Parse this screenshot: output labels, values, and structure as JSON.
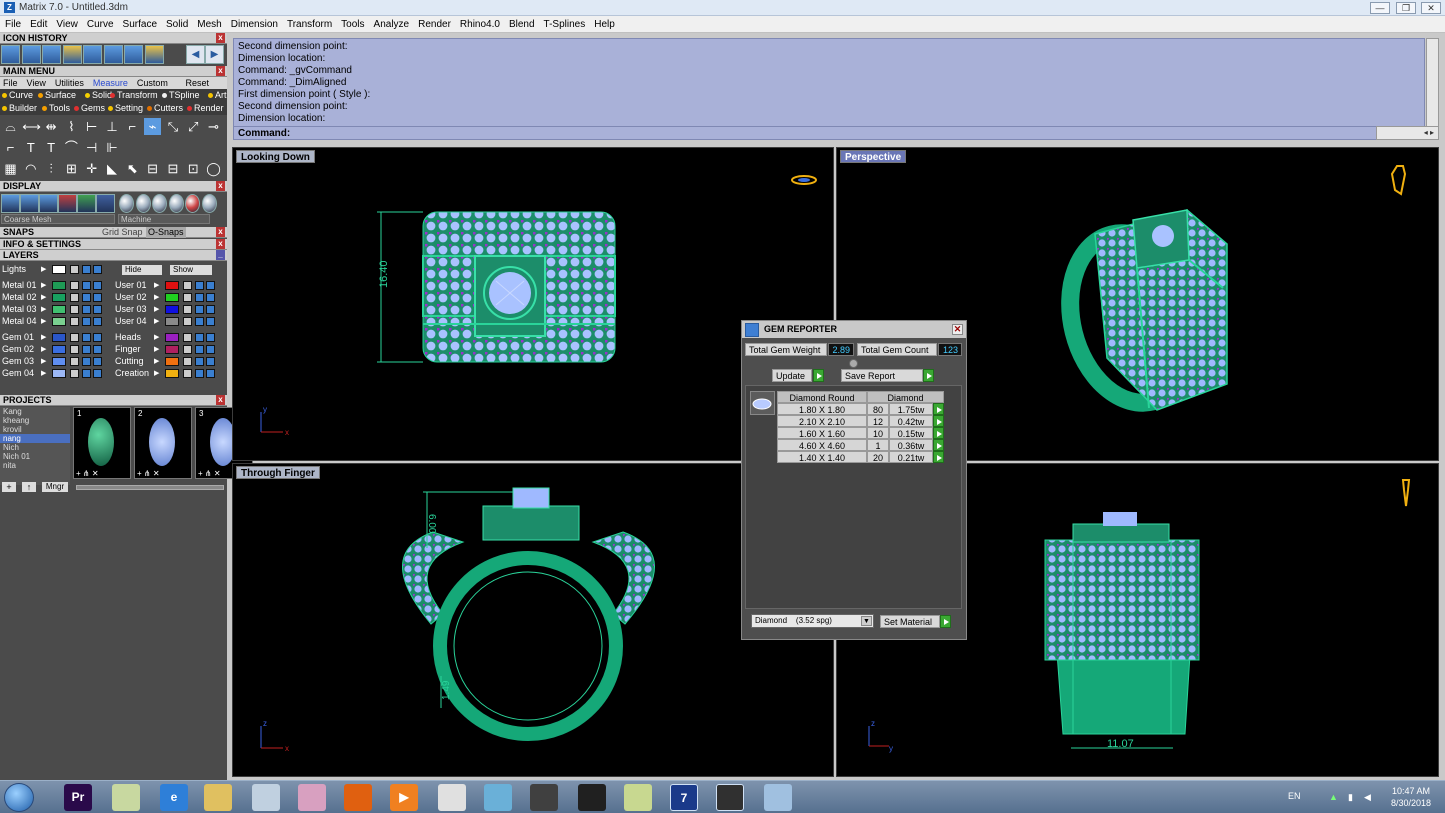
{
  "window": {
    "title": "Matrix 7.0 - Untitled.3dm",
    "min_btn": "—",
    "max_btn": "❐",
    "close_btn": "✕"
  },
  "menubar": [
    "File",
    "Edit",
    "View",
    "Curve",
    "Surface",
    "Solid",
    "Mesh",
    "Dimension",
    "Transform",
    "Tools",
    "Analyze",
    "Render",
    "Rhino4.0",
    "Blend",
    "T-Splines",
    "Help"
  ],
  "left": {
    "icon_history": "ICON HISTORY",
    "main_menu": "MAIN MENU",
    "tabs": [
      "File",
      "View",
      "Utilities",
      "Measure",
      "Custom"
    ],
    "tab_active": "Measure",
    "reset": "Reset",
    "categories_row1": [
      {
        "label": "Curve",
        "color": "#f5c400"
      },
      {
        "label": "Surface",
        "color": "#f5a000"
      },
      {
        "label": "Solid",
        "color": "#f5d000"
      },
      {
        "label": "Transform",
        "color": "#e03030"
      },
      {
        "label": "TSpline",
        "color": "#f0f0f0"
      },
      {
        "label": "Art",
        "color": "#f5c400"
      }
    ],
    "categories_row2": [
      {
        "label": "Builder",
        "color": "#f5c400"
      },
      {
        "label": "Tools",
        "color": "#f5a000"
      },
      {
        "label": "Gems",
        "color": "#e03030"
      },
      {
        "label": "Setting",
        "color": "#f5c400"
      },
      {
        "label": "Cutters",
        "color": "#e07000"
      },
      {
        "label": "Render",
        "color": "#e03030"
      }
    ],
    "display": "DISPLAY",
    "display_mode": "Coarse Mesh",
    "display_machine": "Machine",
    "snaps": "SNAPS",
    "grid_snap": "Grid Snap",
    "osnaps": "O-Snaps",
    "info_settings": "INFO & SETTINGS",
    "layers": "LAYERS",
    "lights": "Lights",
    "hide": "Hide",
    "show": "Show",
    "layers_left": [
      {
        "name": "Metal 01",
        "color": "#1e9a55"
      },
      {
        "name": "Metal 02",
        "color": "#18a060"
      },
      {
        "name": "Metal 03",
        "color": "#40c070"
      },
      {
        "name": "Metal 04",
        "color": "#7ad090"
      },
      {
        "name": "Gem 01",
        "color": "#2a56c8"
      },
      {
        "name": "Gem 02",
        "color": "#3a6ee0"
      },
      {
        "name": "Gem 03",
        "color": "#5f8ef0"
      },
      {
        "name": "Gem 04",
        "color": "#9cb8f6"
      }
    ],
    "layers_right": [
      {
        "name": "User 01",
        "color": "#e01010"
      },
      {
        "name": "User 02",
        "color": "#20d020"
      },
      {
        "name": "User 03",
        "color": "#1010e0"
      },
      {
        "name": "User 04",
        "color": "#8a8a8a"
      },
      {
        "name": "Heads",
        "color": "#9a20c0"
      },
      {
        "name": "Finger",
        "color": "#b02060"
      },
      {
        "name": "Cutting",
        "color": "#f07010"
      },
      {
        "name": "Creation",
        "color": "#f0b010"
      }
    ],
    "projects": "PROJECTS",
    "project_list": [
      "Kang",
      "kheang",
      "krovil",
      "nang",
      "Nich",
      "Nich 01",
      "nita"
    ],
    "project_selected": "nang",
    "thumb_numbers": [
      "1",
      "2",
      "3"
    ],
    "mngr": "Mngr"
  },
  "command": {
    "history": [
      "Second dimension point:",
      "Dimension location:",
      "Command: _gvCommand",
      "Command: _DimAligned",
      "First dimension point ( Style ):",
      "Second dimension point:",
      "Dimension location:"
    ],
    "prompt": "Command:"
  },
  "viewports": {
    "top_left": {
      "label": "Looking Down",
      "dimension": "16.40",
      "axis_x": "x",
      "axis_y": "y"
    },
    "top_right": {
      "label": "Perspective"
    },
    "bottom_left": {
      "label": "Through Finger",
      "dimension_top": "6.00",
      "dimension_bottom": "1.49",
      "axis_x": "x",
      "axis_y": "z"
    },
    "bottom_right": {
      "label": "",
      "dimension": "11.07",
      "axis_x": "y",
      "axis_y": "z"
    }
  },
  "gem_reporter": {
    "title": "GEM REPORTER",
    "total_weight_label": "Total Gem Weight",
    "total_weight": "2.89",
    "total_count_label": "Total Gem Count",
    "total_count": "123",
    "update": "Update",
    "save_report": "Save Report",
    "col_shape": "Diamond Round",
    "col_material": "Diamond",
    "rows": [
      {
        "size": "1.80 X 1.80",
        "count": "80",
        "weight": "1.75tw"
      },
      {
        "size": "2.10 X 2.10",
        "count": "12",
        "weight": "0.42tw"
      },
      {
        "size": "1.60 X 1.60",
        "count": "10",
        "weight": "0.15tw"
      },
      {
        "size": "4.60 X 4.60",
        "count": "1",
        "weight": "0.36tw"
      },
      {
        "size": "1.40 X 1.40",
        "count": "20",
        "weight": "0.21tw"
      }
    ],
    "material": "Diamond",
    "material_density": "(3.52 spg)",
    "set_material": "Set Material"
  },
  "taskbar": {
    "apps": [
      {
        "name": "premiere",
        "color": "#2a0a4a",
        "glyph": "Pr"
      },
      {
        "name": "folder-notes",
        "color": "#c8d8a0",
        "glyph": ""
      },
      {
        "name": "internet-explorer",
        "color": "#2e7fd8",
        "glyph": "e"
      },
      {
        "name": "file-explorer",
        "color": "#e0c060",
        "glyph": ""
      },
      {
        "name": "calculator",
        "color": "#c0d0e0",
        "glyph": ""
      },
      {
        "name": "tool-scissors",
        "color": "#d8a0c0",
        "glyph": ""
      },
      {
        "name": "firefox",
        "color": "#e06010",
        "glyph": ""
      },
      {
        "name": "media-player",
        "color": "#f08020",
        "glyph": "▶"
      },
      {
        "name": "chrome",
        "color": "#e0e0e0",
        "glyph": ""
      },
      {
        "name": "app-blue",
        "color": "#6ab0d8",
        "glyph": ""
      },
      {
        "name": "app-pen",
        "color": "#404040",
        "glyph": ""
      },
      {
        "name": "zbrush",
        "color": "#202020",
        "glyph": ""
      },
      {
        "name": "notes",
        "color": "#c8d890",
        "glyph": ""
      },
      {
        "name": "matrix",
        "color": "#1a3a8a",
        "glyph": "7"
      },
      {
        "name": "rhino",
        "color": "#303030",
        "glyph": ""
      },
      {
        "name": "paint",
        "color": "#a0c0e0",
        "glyph": ""
      }
    ],
    "lang": "EN",
    "time": "10:47 AM",
    "date": "8/30/2018"
  }
}
